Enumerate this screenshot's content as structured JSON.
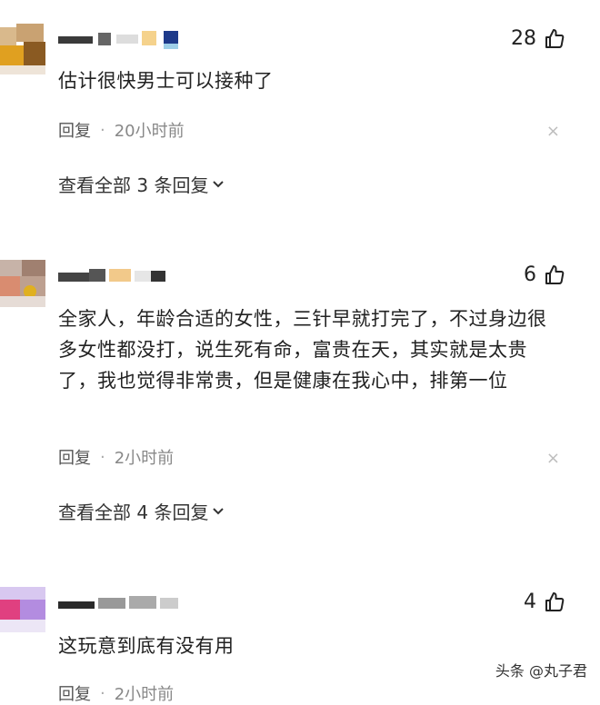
{
  "comments": [
    {
      "likes": "28",
      "text": "估计很快男士可以接种了",
      "reply_label": "回复",
      "time": "20小时前",
      "more_replies": "查看全部 3 条回复",
      "close": "×"
    },
    {
      "likes": "6",
      "text": "全家人，年龄合适的女性，三针早就打完了，不过身边很多女性都没打，说生死有命，富贵在天，其实就是太贵了，我也觉得非常贵，但是健康在我心中，排第一位",
      "reply_label": "回复",
      "time": "2小时前",
      "more_replies": "查看全部 4 条回复",
      "close": "×"
    },
    {
      "likes": "4",
      "text": "这玩意到底有没有用",
      "reply_label": "回复",
      "time": "2小时前"
    }
  ],
  "watermark": "头条 @丸子君",
  "icons": {
    "thumb": "thumbs-up-icon",
    "chevron": "chevron-down-icon",
    "close": "close-icon"
  }
}
